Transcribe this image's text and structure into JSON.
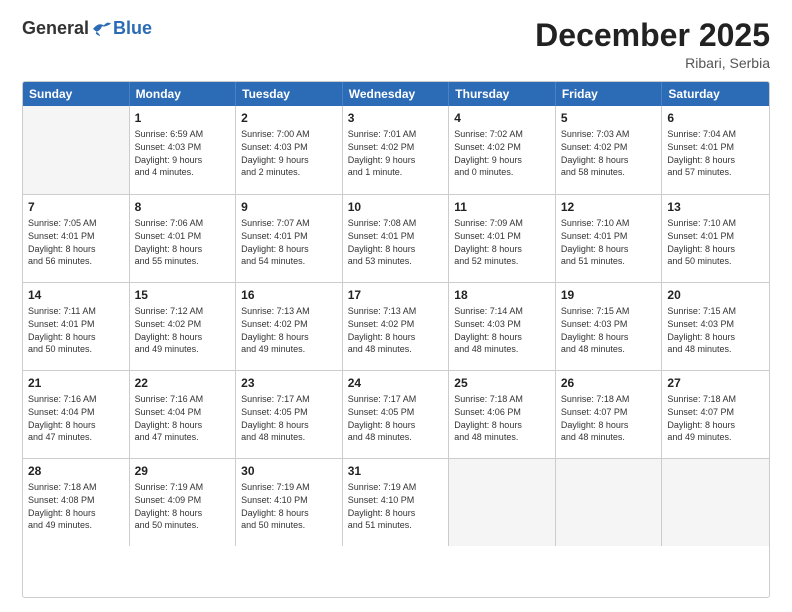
{
  "header": {
    "logo": {
      "general": "General",
      "blue": "Blue"
    },
    "title": "December 2025",
    "location": "Ribari, Serbia"
  },
  "calendar": {
    "weekdays": [
      "Sunday",
      "Monday",
      "Tuesday",
      "Wednesday",
      "Thursday",
      "Friday",
      "Saturday"
    ],
    "rows": [
      [
        {
          "day": "",
          "info": ""
        },
        {
          "day": "1",
          "info": "Sunrise: 6:59 AM\nSunset: 4:03 PM\nDaylight: 9 hours\nand 4 minutes."
        },
        {
          "day": "2",
          "info": "Sunrise: 7:00 AM\nSunset: 4:03 PM\nDaylight: 9 hours\nand 2 minutes."
        },
        {
          "day": "3",
          "info": "Sunrise: 7:01 AM\nSunset: 4:02 PM\nDaylight: 9 hours\nand 1 minute."
        },
        {
          "day": "4",
          "info": "Sunrise: 7:02 AM\nSunset: 4:02 PM\nDaylight: 9 hours\nand 0 minutes."
        },
        {
          "day": "5",
          "info": "Sunrise: 7:03 AM\nSunset: 4:02 PM\nDaylight: 8 hours\nand 58 minutes."
        },
        {
          "day": "6",
          "info": "Sunrise: 7:04 AM\nSunset: 4:01 PM\nDaylight: 8 hours\nand 57 minutes."
        }
      ],
      [
        {
          "day": "7",
          "info": "Sunrise: 7:05 AM\nSunset: 4:01 PM\nDaylight: 8 hours\nand 56 minutes."
        },
        {
          "day": "8",
          "info": "Sunrise: 7:06 AM\nSunset: 4:01 PM\nDaylight: 8 hours\nand 55 minutes."
        },
        {
          "day": "9",
          "info": "Sunrise: 7:07 AM\nSunset: 4:01 PM\nDaylight: 8 hours\nand 54 minutes."
        },
        {
          "day": "10",
          "info": "Sunrise: 7:08 AM\nSunset: 4:01 PM\nDaylight: 8 hours\nand 53 minutes."
        },
        {
          "day": "11",
          "info": "Sunrise: 7:09 AM\nSunset: 4:01 PM\nDaylight: 8 hours\nand 52 minutes."
        },
        {
          "day": "12",
          "info": "Sunrise: 7:10 AM\nSunset: 4:01 PM\nDaylight: 8 hours\nand 51 minutes."
        },
        {
          "day": "13",
          "info": "Sunrise: 7:10 AM\nSunset: 4:01 PM\nDaylight: 8 hours\nand 50 minutes."
        }
      ],
      [
        {
          "day": "14",
          "info": "Sunrise: 7:11 AM\nSunset: 4:01 PM\nDaylight: 8 hours\nand 50 minutes."
        },
        {
          "day": "15",
          "info": "Sunrise: 7:12 AM\nSunset: 4:02 PM\nDaylight: 8 hours\nand 49 minutes."
        },
        {
          "day": "16",
          "info": "Sunrise: 7:13 AM\nSunset: 4:02 PM\nDaylight: 8 hours\nand 49 minutes."
        },
        {
          "day": "17",
          "info": "Sunrise: 7:13 AM\nSunset: 4:02 PM\nDaylight: 8 hours\nand 48 minutes."
        },
        {
          "day": "18",
          "info": "Sunrise: 7:14 AM\nSunset: 4:03 PM\nDaylight: 8 hours\nand 48 minutes."
        },
        {
          "day": "19",
          "info": "Sunrise: 7:15 AM\nSunset: 4:03 PM\nDaylight: 8 hours\nand 48 minutes."
        },
        {
          "day": "20",
          "info": "Sunrise: 7:15 AM\nSunset: 4:03 PM\nDaylight: 8 hours\nand 48 minutes."
        }
      ],
      [
        {
          "day": "21",
          "info": "Sunrise: 7:16 AM\nSunset: 4:04 PM\nDaylight: 8 hours\nand 47 minutes."
        },
        {
          "day": "22",
          "info": "Sunrise: 7:16 AM\nSunset: 4:04 PM\nDaylight: 8 hours\nand 47 minutes."
        },
        {
          "day": "23",
          "info": "Sunrise: 7:17 AM\nSunset: 4:05 PM\nDaylight: 8 hours\nand 48 minutes."
        },
        {
          "day": "24",
          "info": "Sunrise: 7:17 AM\nSunset: 4:05 PM\nDaylight: 8 hours\nand 48 minutes."
        },
        {
          "day": "25",
          "info": "Sunrise: 7:18 AM\nSunset: 4:06 PM\nDaylight: 8 hours\nand 48 minutes."
        },
        {
          "day": "26",
          "info": "Sunrise: 7:18 AM\nSunset: 4:07 PM\nDaylight: 8 hours\nand 48 minutes."
        },
        {
          "day": "27",
          "info": "Sunrise: 7:18 AM\nSunset: 4:07 PM\nDaylight: 8 hours\nand 49 minutes."
        }
      ],
      [
        {
          "day": "28",
          "info": "Sunrise: 7:18 AM\nSunset: 4:08 PM\nDaylight: 8 hours\nand 49 minutes."
        },
        {
          "day": "29",
          "info": "Sunrise: 7:19 AM\nSunset: 4:09 PM\nDaylight: 8 hours\nand 50 minutes."
        },
        {
          "day": "30",
          "info": "Sunrise: 7:19 AM\nSunset: 4:10 PM\nDaylight: 8 hours\nand 50 minutes."
        },
        {
          "day": "31",
          "info": "Sunrise: 7:19 AM\nSunset: 4:10 PM\nDaylight: 8 hours\nand 51 minutes."
        },
        {
          "day": "",
          "info": ""
        },
        {
          "day": "",
          "info": ""
        },
        {
          "day": "",
          "info": ""
        }
      ]
    ]
  }
}
